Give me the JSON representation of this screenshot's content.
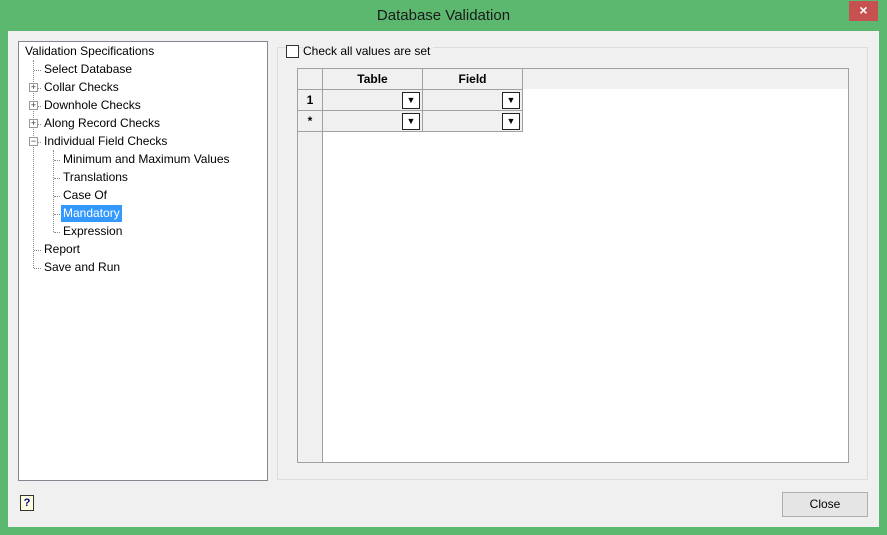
{
  "window": {
    "title": "Database Validation",
    "close_icon": "×"
  },
  "tree": {
    "root": "Validation Specifications",
    "items": [
      {
        "label": "Select Database"
      },
      {
        "label": "Collar Checks",
        "expander": "+"
      },
      {
        "label": "Downhole Checks",
        "expander": "+"
      },
      {
        "label": "Along Record Checks",
        "expander": "+"
      },
      {
        "label": "Individual Field Checks",
        "expander": "−"
      },
      {
        "label": "Minimum and Maximum Values"
      },
      {
        "label": "Translations"
      },
      {
        "label": "Case Of"
      },
      {
        "label": "Mandatory",
        "selected": true
      },
      {
        "label": "Expression"
      },
      {
        "label": "Report"
      },
      {
        "label": "Save and Run"
      }
    ]
  },
  "options": {
    "check_all_label": "Check all values are set",
    "check_all_checked": false
  },
  "grid": {
    "columns": [
      "Table",
      "Field"
    ],
    "rows": [
      {
        "header": "1",
        "table": "",
        "field": ""
      },
      {
        "header": "*",
        "table": "",
        "field": ""
      }
    ],
    "dropdown_icon": "▼"
  },
  "footer": {
    "help_icon": "?",
    "close_label": "Close"
  },
  "colors": {
    "frame": "#5cb86f",
    "selection": "#3399ff",
    "close_hover": "#c75050"
  }
}
